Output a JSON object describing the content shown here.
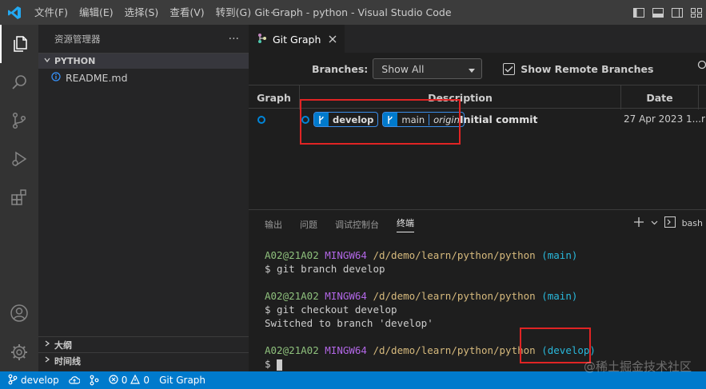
{
  "window": {
    "title": "Git Graph - python - Visual Studio Code",
    "menu": [
      "文件(F)",
      "编辑(E)",
      "选择(S)",
      "查看(V)",
      "转到(G)",
      "···"
    ]
  },
  "sidebar": {
    "header": "资源管理器",
    "more": "···",
    "root_folder": "PYTHON",
    "files": [
      "README.md"
    ],
    "bottom_sections": [
      "大纲",
      "时间线"
    ]
  },
  "editor": {
    "tab_label": "Git Graph",
    "branches_label": "Branches:",
    "branches_value": "Show All",
    "show_remote_label": "Show Remote Branches",
    "columns": [
      "Graph",
      "Description",
      "Date"
    ],
    "commit": {
      "refs": [
        {
          "name": "develop",
          "remote": ""
        },
        {
          "name": "main",
          "remote": "origin"
        }
      ],
      "message": "Initial commit",
      "date": "27 Apr 2023 1...",
      "author_fragment": "r"
    }
  },
  "panel": {
    "tabs": [
      "输出",
      "问题",
      "调试控制台",
      "终端"
    ],
    "active_tab": "终端",
    "shell_label": "bash",
    "terminal": [
      {
        "user": "A02@21A02",
        "host": "MINGW64",
        "path": "/d/demo/learn/python/python",
        "branch": "(main)"
      },
      {
        "text": "$ git branch develop"
      },
      {
        "text": ""
      },
      {
        "user": "A02@21A02",
        "host": "MINGW64",
        "path": "/d/demo/learn/python/python",
        "branch": "(main)"
      },
      {
        "text": "$ git checkout develop"
      },
      {
        "text": "Switched to branch 'develop'"
      },
      {
        "text": ""
      },
      {
        "user": "A02@21A02",
        "host": "MINGW64",
        "path": "/d/demo/learn/python/python",
        "branch": "(develop)"
      },
      {
        "text": "$ "
      }
    ]
  },
  "statusbar": {
    "branch": "develop",
    "errors": "0",
    "warnings": "0",
    "git_graph": "Git Graph"
  },
  "watermark": "@稀土掘金技术社区",
  "colors": {
    "accent": "#007acc",
    "highlight_box": "#e02424"
  }
}
